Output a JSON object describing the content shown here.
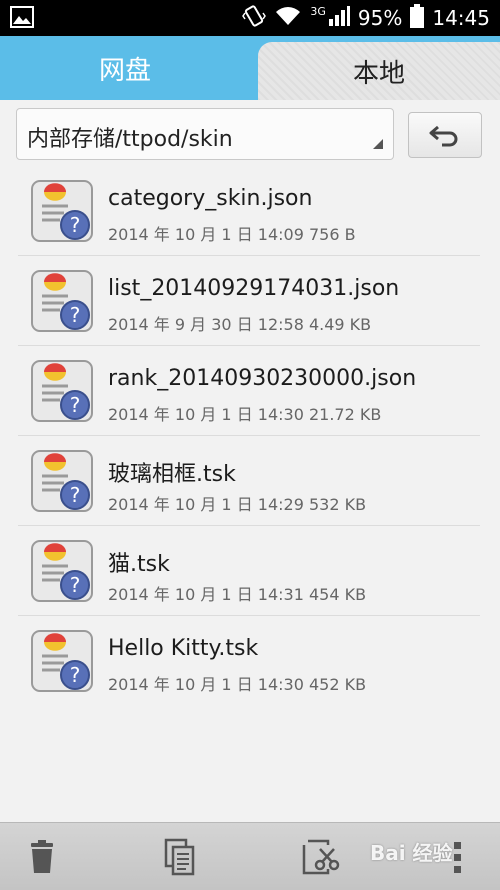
{
  "status_bar": {
    "network": "3G",
    "battery": "95%",
    "time": "14:45",
    "icons": [
      "gallery-icon",
      "vibrate-icon",
      "wifi-icon",
      "signal-icon",
      "battery-icon"
    ]
  },
  "tabs": [
    {
      "label": "网盘",
      "active": false
    },
    {
      "label": "本地",
      "active": true
    }
  ],
  "path_bar": {
    "path": "内部存储/ttpod/skin",
    "back_icon": "back-arrow-icon"
  },
  "files": [
    {
      "name": "category_skin.json",
      "meta": "2014 年 10 月 1 日 14:09 756 B"
    },
    {
      "name": "list_20140929174031.json",
      "meta": "2014 年 9 月 30 日 12:58 4.49 KB"
    },
    {
      "name": "rank_20140930230000.json",
      "meta": "2014 年 10 月 1 日 14:30 21.72 KB"
    },
    {
      "name": "玻璃相框.tsk",
      "meta": "2014 年 10 月 1 日 14:29 532 KB"
    },
    {
      "name": "猫.tsk",
      "meta": "2014 年 10 月 1 日 14:31 454 KB"
    },
    {
      "name": "Hello Kitty.tsk",
      "meta": "2014 年 10 月 1 日 14:30 452 KB"
    }
  ],
  "toolbar": {
    "icons": [
      "trash-icon",
      "copy-icon",
      "cut-icon",
      "more-icon"
    ],
    "watermark": "Bai 经验"
  }
}
